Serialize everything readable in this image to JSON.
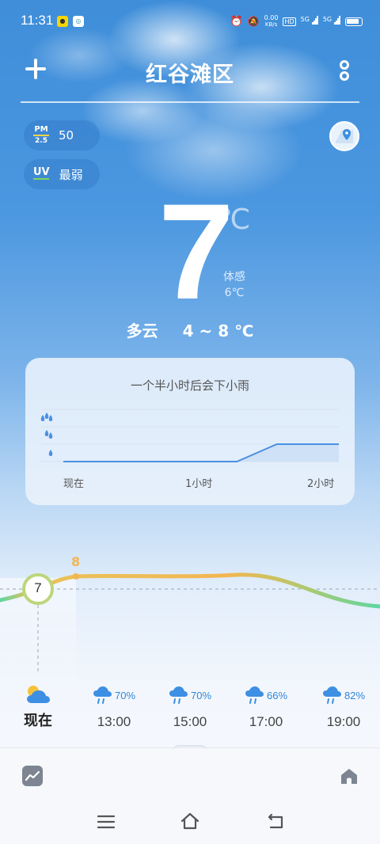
{
  "status_bar": {
    "time": "11:31",
    "icons": [
      "alarm-icon",
      "mute-icon",
      "hd-icon",
      "signal-icon",
      "5g-icon",
      "battery-icon"
    ],
    "net_speed": "0.00",
    "net_unit": "KB/s",
    "hd": "HD",
    "network1": "5G",
    "network2": "5G"
  },
  "header": {
    "city": "红谷滩区",
    "add_icon": "plus-icon",
    "more_icon": "more-icon"
  },
  "air": {
    "pm_label_top": "PM",
    "pm_label_bottom": "2.5",
    "pm_value": "50",
    "uv_label": "UV",
    "uv_value": "最弱"
  },
  "current": {
    "temp": "7",
    "unit": "℃",
    "feels_label": "体感",
    "feels_value": "6℃",
    "condition": "多云",
    "range": "4 ~ 8 ℃"
  },
  "precip_card": {
    "title": "一个半小时后会下小雨",
    "ticks": [
      "现在",
      "1小时",
      "2小时"
    ],
    "accent": "#4a90e2",
    "chart_data": {
      "type": "area",
      "x": [
        0,
        1.26,
        1.55,
        2.0
      ],
      "values": [
        0,
        0,
        1,
        1
      ],
      "xticks": [
        "现在",
        "1小时",
        "2小时"
      ],
      "levels": [
        "小雨",
        "中雨",
        "大雨"
      ]
    }
  },
  "trend": {
    "current_temp": "7",
    "max_label": "8",
    "line_colors": [
      "#f3b652",
      "#5fd6a2"
    ]
  },
  "hourly": [
    {
      "time": "现在",
      "pct": "",
      "icon": "partly-cloudy-icon"
    },
    {
      "time": "13:00",
      "pct": "70%",
      "icon": "rain-cloud-icon"
    },
    {
      "time": "15:00",
      "pct": "70%",
      "icon": "rain-cloud-icon"
    },
    {
      "time": "17:00",
      "pct": "66%",
      "icon": "rain-cloud-icon"
    },
    {
      "time": "19:00",
      "pct": "82%",
      "icon": "rain-cloud-icon"
    }
  ]
}
